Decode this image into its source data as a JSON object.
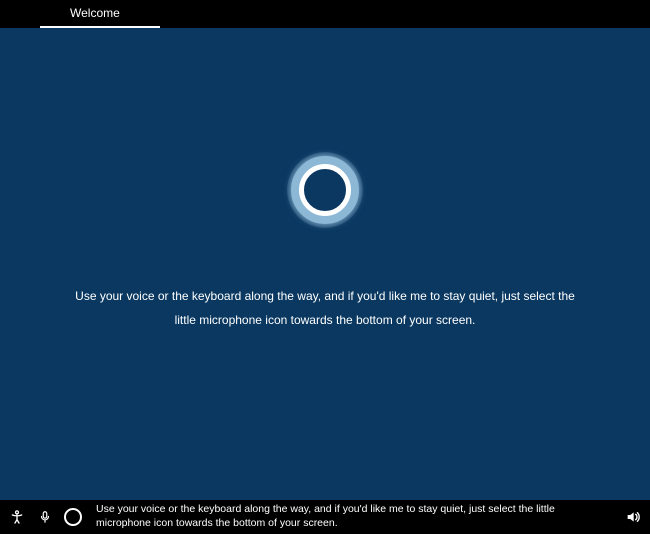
{
  "header": {
    "tab_label": "Welcome"
  },
  "main": {
    "message": "Use your voice or the keyboard along the way, and if you'd like me to stay quiet, just select the little microphone icon towards the bottom of your screen."
  },
  "footer": {
    "caption": "Use your voice or the keyboard along the way, and if you'd like me to stay quiet, just select the little microphone icon towards the bottom of your screen.",
    "icons": {
      "accessibility": "accessibility-icon",
      "microphone": "microphone-icon",
      "cortana": "cortana-icon",
      "volume": "volume-icon"
    }
  },
  "colors": {
    "background_main": "#0a3861",
    "background_bar": "#000000",
    "text": "#ffffff",
    "ring_outer": "#8cb8d6",
    "ring_inner": "#ffffff"
  }
}
